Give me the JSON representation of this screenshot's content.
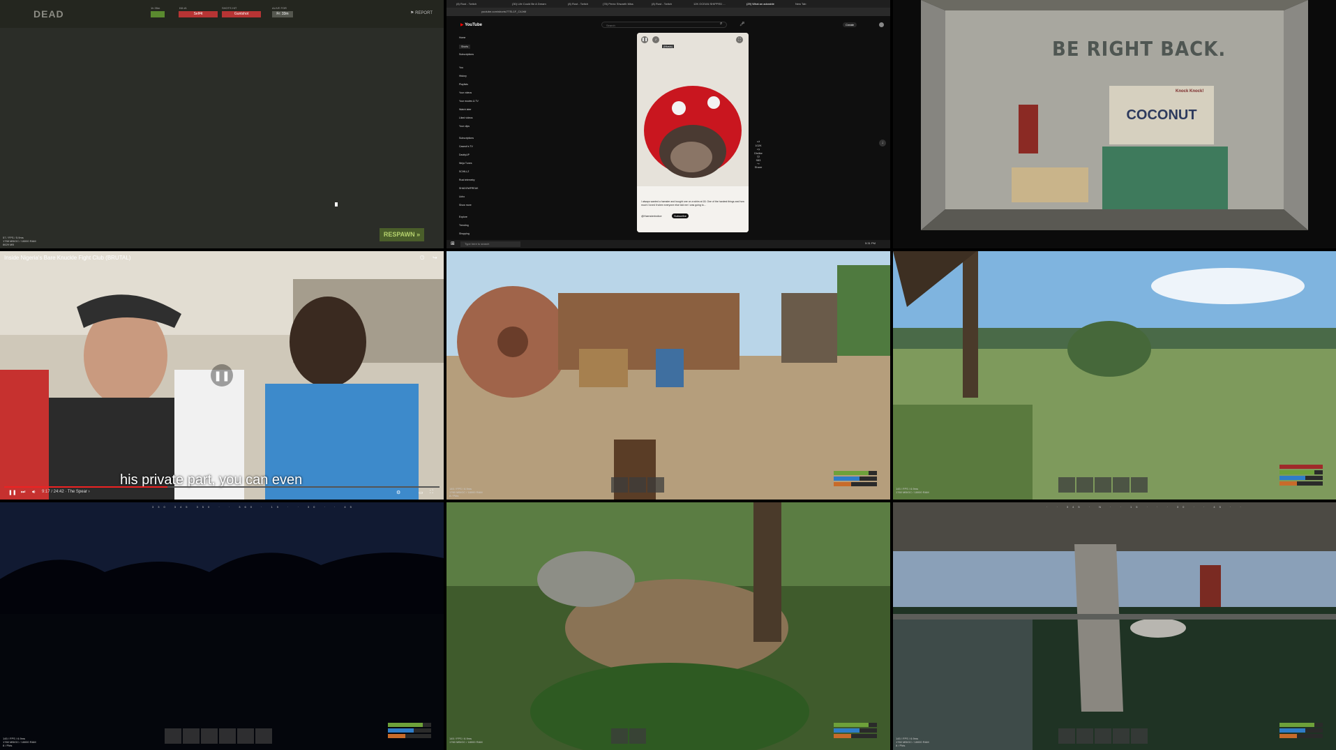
{
  "cell1": {
    "title": "DEAD",
    "stat_labels": [
      "1h 35m",
      "Kill #1",
      "SHOTS HIT",
      "ALIVE FOR"
    ],
    "stat_values": [
      "Self4t",
      "Guntshot",
      "Fr: 33m"
    ],
    "report_label": "REPORT",
    "respawn_label": "RESPAWN »",
    "fps_lines": [
      "57 / FPS / 5.9ms",
      "1758 MB/GC / 18000 RAM",
      "8629 MB"
    ]
  },
  "cell2": {
    "tabs": [
      "(8) Rust - Twitch",
      "(30) Life Could Be A Dream",
      "(8) Rust - Twitch",
      "(78) Perez Shwarth Miss",
      "(8) Rust - Twitch",
      "12K OCEAN SHIPPED ...",
      "(29) What an adorable",
      "New Tab"
    ],
    "url": "youtube.com/shorts/7TSL1F_C4JrM",
    "logo": "YouTube",
    "search_placeholder": "Search",
    "sidebar": [
      "Home",
      "Shorts",
      "Subscriptions",
      "You",
      "History",
      "Playlists",
      "Your videos",
      "Your movies & TV",
      "Watch later",
      "Liked videos",
      "Your clips",
      "Subscriptions",
      "Caseoh's TV",
      "DaddyUP",
      "Ninja Tunes",
      "SCHILLZ",
      "Rust telemetry",
      "SHADOWFREAK",
      "Ucho",
      "Show more",
      "Explore",
      "Trending",
      "Shopping"
    ],
    "short_caption": "(Music)",
    "short_desc": "I always wanted a hamster and bought one on a whim at 18. One of the hardest things and how much I loved it when everyone else told me I was going to...",
    "channel": "@Hamsterindice",
    "subscribe": "Subscribe",
    "actions": [
      "102K",
      "Dislike",
      "983",
      "Share"
    ],
    "taskbar_search": "Type here to search",
    "create": "Create",
    "clock": "5:31 PM"
  },
  "cell3": {
    "sign": "BE RIGHT BACK.",
    "poster": "COCONUT",
    "poster_small": "Knock Knock!"
  },
  "cell4": {
    "title": "Inside Nigeria's Bare Knuckle Fight Club (BRUTAL)",
    "subtitle": "his private part, you can even",
    "time": "9:17 / 24:42 · The Spear ›",
    "progress": 0.375
  },
  "hud": {
    "fps": [
      "145 / FPS / 6.9ms",
      "1760 MB/GC / 18000 RAM",
      "8 / Pkts"
    ],
    "health": 80,
    "hydration": 60,
    "food": 40,
    "health_color": "#6ea13a",
    "water_color": "#2f7cc7",
    "food_color": "#c86b2a"
  },
  "cell7": {
    "compass": "330 345 350 · · 360 · 15 · · 30 · · 45"
  },
  "cell9": {
    "compass": "· · 345 · N · · 15 · · · 30 · · 45 · ·"
  }
}
